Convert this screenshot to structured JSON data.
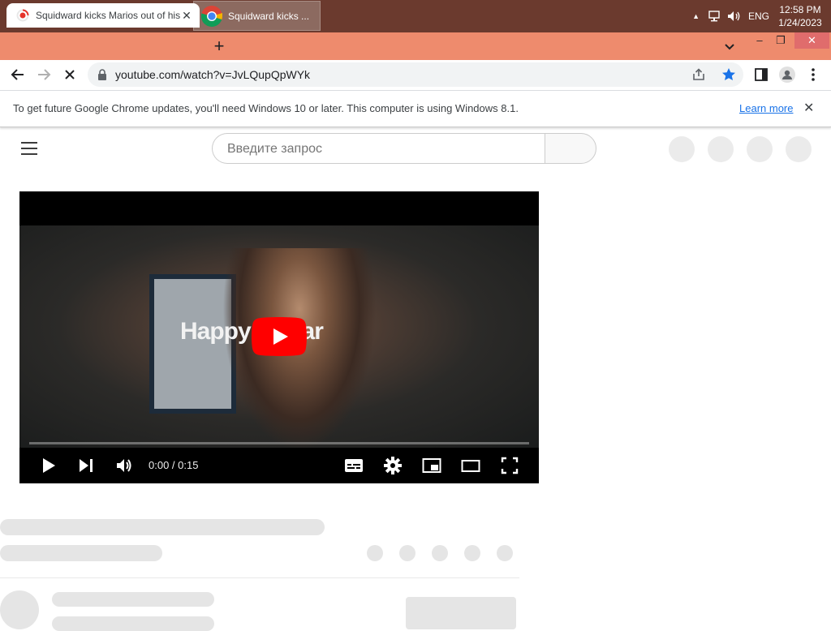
{
  "taskbar": {
    "chrome_task_label": "Squidward kicks ...",
    "language": "ENG",
    "time": "12:58 PM",
    "date": "1/24/2023"
  },
  "tab": {
    "title": "Squidward kicks Marios out of his",
    "close_icon": "close-icon"
  },
  "window_controls": {
    "minimize": "–",
    "restore": "❐",
    "close": "✕"
  },
  "toolbar": {
    "url": "youtube.com/watch?v=JvLQupQpWYk"
  },
  "infobar": {
    "message": "To get future Google Chrome updates, you'll need Windows 10 or later. This computer is using Windows 8.1.",
    "learn_more": "Learn more"
  },
  "youtube": {
    "search_placeholder": "Введите запрос",
    "video_caption": "Happy    J Year",
    "timecode": "0:00 / 0:15",
    "progress": 0
  },
  "colors": {
    "taskbar": "#6b3a2e",
    "tabstrip": "#ee8b6d",
    "youtube_red": "#ff0000",
    "star_blue": "#1a73e8"
  }
}
